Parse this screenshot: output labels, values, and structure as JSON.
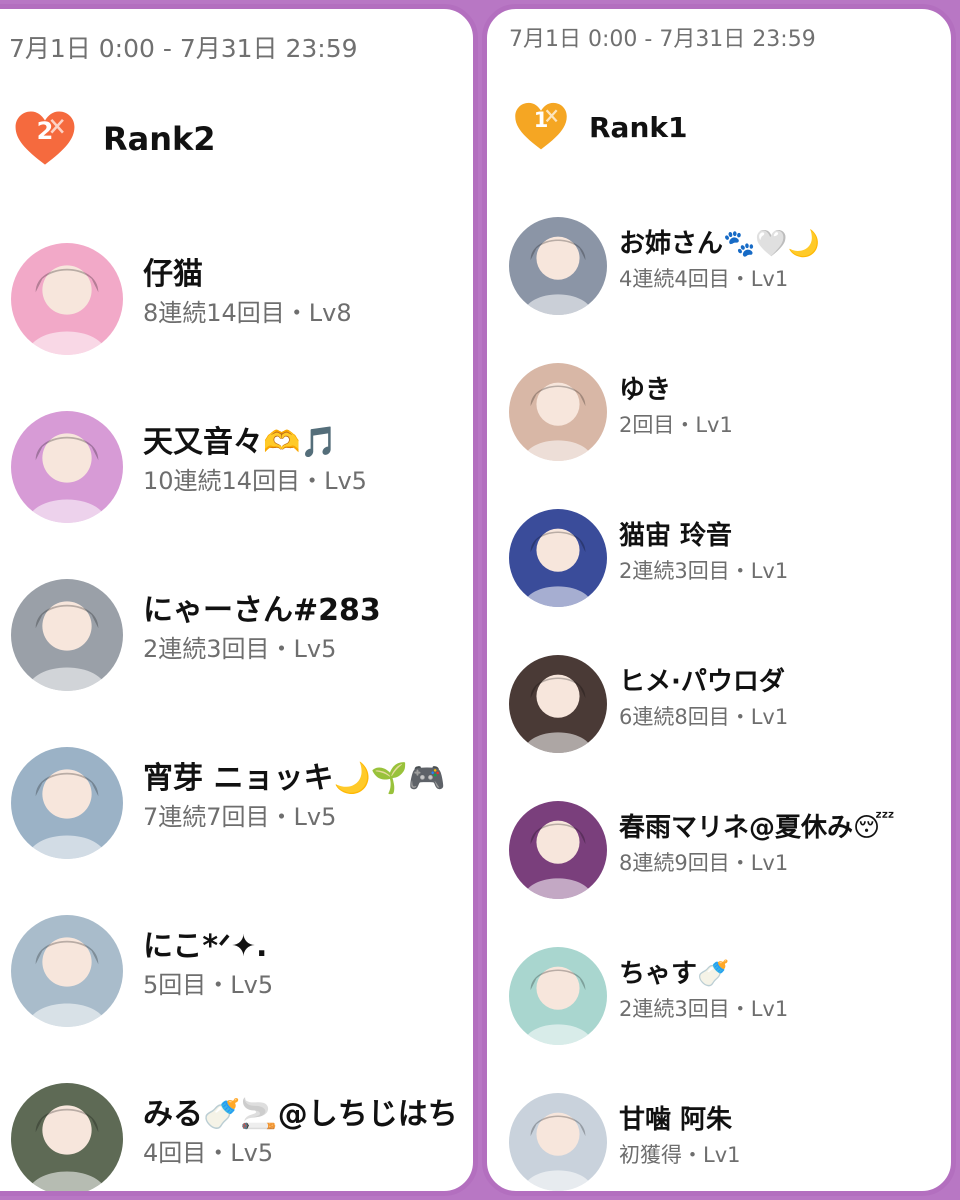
{
  "left": {
    "date_range": "7月1日 0:00 - 7月31日 23:59",
    "rank_number": "2",
    "rank_label": "Rank2",
    "heart_color": "#f56a3e",
    "users": [
      {
        "name": "仔猫",
        "meta": "8連続14回目・Lv8",
        "avatar_color": "#f2a9c8"
      },
      {
        "name": "天又音々🫶🎵",
        "meta": "10連続14回目・Lv5",
        "avatar_color": "#d79bd6"
      },
      {
        "name": "にゃーさん#283",
        "meta": "2連続3回目・Lv5",
        "avatar_color": "#9aa0a8"
      },
      {
        "name": "宵芽 ニョッキ🌙🌱🎮",
        "meta": "7連続7回目・Lv5",
        "avatar_color": "#9bb2c6"
      },
      {
        "name": "にこ*ᐟ✦.",
        "meta": "5回目・Lv5",
        "avatar_color": "#a9bccb"
      },
      {
        "name": "みる🍼🚬@しちじはち",
        "meta": "4回目・Lv5",
        "avatar_color": "#5e6a55"
      }
    ]
  },
  "right": {
    "date_range": "7月1日 0:00 - 7月31日 23:59",
    "rank_number": "1",
    "rank_label": "Rank1",
    "heart_color": "#f5a623",
    "users": [
      {
        "name": "お姉さん🐾🤍🌙",
        "meta": "4連続4回目・Lv1",
        "avatar_color": "#8b95a6"
      },
      {
        "name": "ゆき",
        "meta": "2回目・Lv1",
        "avatar_color": "#d8b7a6"
      },
      {
        "name": "猫宙 玲音",
        "meta": "2連続3回目・Lv1",
        "avatar_color": "#3a4c9a"
      },
      {
        "name": "ヒメ·パウロダ",
        "meta": "6連続8回目・Lv1",
        "avatar_color": "#4a3a36"
      },
      {
        "name": "春雨マリネ@夏休み😴",
        "meta": "8連続9回目・Lv1",
        "avatar_color": "#7a3f7c"
      },
      {
        "name": "ちゃす🍼",
        "meta": "2連続3回目・Lv1",
        "avatar_color": "#a9d6cf"
      },
      {
        "name": "甘噛 阿朱",
        "meta": "初獲得・Lv1",
        "avatar_color": "#c9d2dc"
      }
    ]
  }
}
